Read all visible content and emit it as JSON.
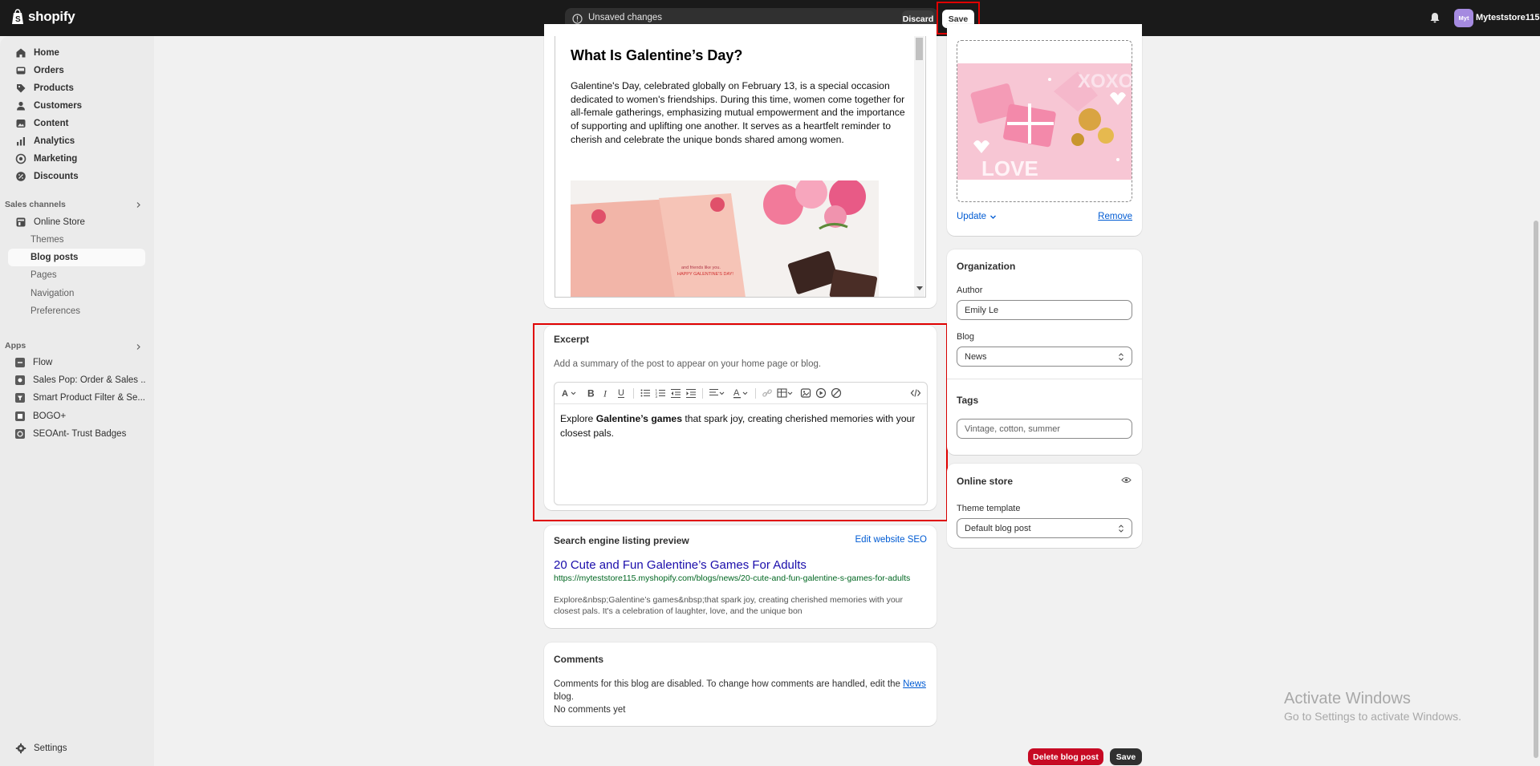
{
  "topbar": {
    "logo_text": "shopify",
    "unsaved_label": "Unsaved changes",
    "discard_label": "Discard",
    "save_label": "Save",
    "avatar_initials": "Myt",
    "store_name": "Myteststore115"
  },
  "sidebar": {
    "main_items": [
      {
        "label": "Home",
        "icon": "home-icon"
      },
      {
        "label": "Orders",
        "icon": "inbox-icon"
      },
      {
        "label": "Products",
        "icon": "tag-icon"
      },
      {
        "label": "Customers",
        "icon": "person-icon"
      },
      {
        "label": "Content",
        "icon": "image-icon"
      },
      {
        "label": "Analytics",
        "icon": "chart-icon"
      },
      {
        "label": "Marketing",
        "icon": "target-icon"
      },
      {
        "label": "Discounts",
        "icon": "discount-icon"
      }
    ],
    "sales_channels_title": "Sales channels",
    "online_store_label": "Online Store",
    "online_store_sub": [
      "Themes",
      "Blog posts",
      "Pages",
      "Navigation",
      "Preferences"
    ],
    "apps_title": "Apps",
    "apps": [
      "Flow",
      "Sales Pop: Order & Sales ...",
      "Smart Product Filter & Se...",
      "BOGO+",
      "SEOAnt- Trust Badges"
    ],
    "settings_label": "Settings"
  },
  "editor": {
    "heading": "What Is Galentine’s Day?",
    "paragraph": "Galentine's Day, celebrated globally on February 13, is a special occasion dedicated to women's friendships. During this time, women come together for all-female gatherings, emphasizing mutual empowerment and the importance of supporting and uplifting one another. It serves as a heartfelt reminder to cherish and celebrate the unique bonds shared among women.",
    "card_text": "and friends like you.\nHAPPY GALENTINE'S DAY!"
  },
  "excerpt": {
    "title": "Excerpt",
    "hint": "Add a summary of the post to appear on your home page or blog.",
    "text_before": "Explore ",
    "text_bold": "Galentine’s games",
    "text_after": " that spark joy, creating cherished memories with your closest pals."
  },
  "seo": {
    "title": "Search engine listing preview",
    "edit_label": "Edit website SEO",
    "page_title": "20 Cute and Fun Galentine’s Games For Adults",
    "url": "https://myteststore115.myshopify.com/blogs/news/20-cute-and-fun-galentine-s-games-for-adults",
    "description": "Explore&nbsp;Galentine’s games&nbsp;that spark joy, creating cherished memories with your closest pals. It's a celebration of laughter, love, and the unique bon"
  },
  "comments": {
    "title": "Comments",
    "text_before": "Comments for this blog are disabled. To change how comments are handled, edit the ",
    "link": "News",
    "text_after": " blog.",
    "empty": "No comments yet"
  },
  "image_card": {
    "update_label": "Update",
    "remove_label": "Remove",
    "art_text_1": "XOXO",
    "art_text_2": "LOVE"
  },
  "organization": {
    "title": "Organization",
    "author_label": "Author",
    "author_value": "Emily Le",
    "blog_label": "Blog",
    "blog_value": "News",
    "tags_label": "Tags",
    "tags_placeholder": "Vintage, cotton, summer"
  },
  "online_store": {
    "title": "Online store",
    "template_label": "Theme template",
    "template_value": "Default blog post"
  },
  "actions": {
    "delete_label": "Delete blog post",
    "save_label": "Save"
  },
  "watermark": {
    "line1": "Activate Windows",
    "line2": "Go to Settings to activate Windows."
  },
  "colors": {
    "highlight": "#e00000",
    "link": "#005bd3",
    "delete": "#c70a24"
  }
}
